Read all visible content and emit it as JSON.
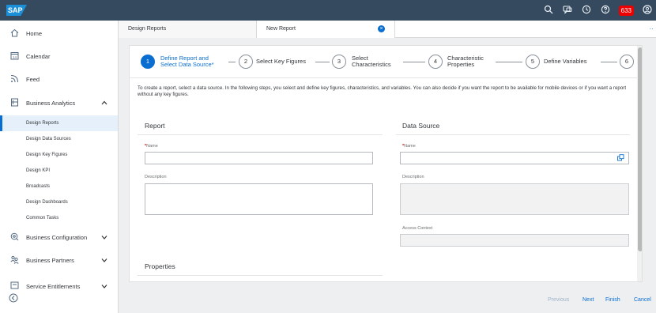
{
  "shell": {
    "logo": "SAP",
    "notification_count": "633",
    "icons": [
      "search-icon",
      "help-chat-icon",
      "clock-icon",
      "help-icon",
      "user-icon"
    ]
  },
  "sidebar": {
    "items": [
      {
        "label": "Home",
        "icon": "home-icon"
      },
      {
        "label": "Calendar",
        "icon": "calendar-icon"
      },
      {
        "label": "Feed",
        "icon": "feed-icon"
      },
      {
        "label": "Business Analytics",
        "icon": "analytics-icon",
        "expanded": true
      },
      {
        "label": "Business Configuration",
        "icon": "configuration-icon"
      },
      {
        "label": "Business Partners",
        "icon": "partners-icon"
      },
      {
        "label": "Service Entitlements",
        "icon": "entitlements-icon"
      }
    ],
    "sub_items": [
      {
        "label": "Design Reports",
        "active": true
      },
      {
        "label": "Design Data Sources"
      },
      {
        "label": "Design Key Figures"
      },
      {
        "label": "Design KPI"
      },
      {
        "label": "Broadcasts"
      },
      {
        "label": "Design Dashboards"
      },
      {
        "label": "Common Tasks"
      }
    ]
  },
  "tabs": [
    {
      "label": "Design Reports"
    },
    {
      "label": "New Report",
      "closable": true
    }
  ],
  "wizard": {
    "steps": [
      {
        "number": "1",
        "label_line1": "Define Report and",
        "label_line2": "Select Data Source*",
        "active": true
      },
      {
        "number": "2",
        "label_line1": "Select Key Figures",
        "label_line2": ""
      },
      {
        "number": "3",
        "label_line1": "Select",
        "label_line2": "Characteristics"
      },
      {
        "number": "4",
        "label_line1": "Characteristic",
        "label_line2": "Properties"
      },
      {
        "number": "5",
        "label_line1": "Define Variables",
        "label_line2": ""
      },
      {
        "number": "6",
        "label_line1": "",
        "label_line2": ""
      }
    ],
    "intro_text": "To create a report, select a data source. In the following steps, you select and define key figures, characteristics, and variables. You can also decide if you want the report to be available for mobile devices or if you want a report without any key figures."
  },
  "report": {
    "title": "Report",
    "name_label": "Name",
    "name_value": "",
    "description_label": "Description",
    "description_value": ""
  },
  "data_source": {
    "title": "Data Source",
    "name_label": "Name",
    "name_value": "",
    "description_label": "Description",
    "access_context_label": "Access Context"
  },
  "properties": {
    "title": "Properties"
  },
  "footer": {
    "previous": "Previous",
    "next": "Next",
    "finish": "Finish",
    "cancel": "Cancel"
  },
  "colors": {
    "shell": "#354a5f",
    "accent": "#0a6ed1",
    "notification": "#ee0000"
  }
}
